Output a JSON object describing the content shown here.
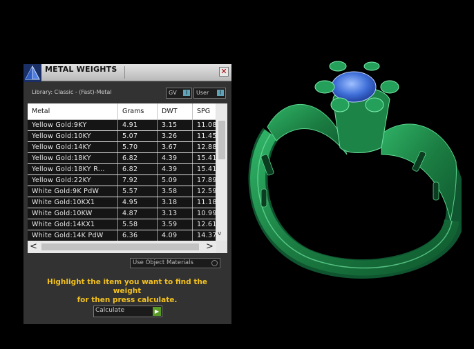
{
  "window": {
    "title": "METAL WEIGHTS",
    "close_glyph": "✕"
  },
  "library": {
    "label": "Library: Classic - (Fast)-Metal"
  },
  "toggles": {
    "gv": {
      "label": "GV",
      "indicator": "I"
    },
    "user": {
      "label": "User",
      "indicator": "I"
    }
  },
  "table": {
    "columns": [
      "Metal",
      "Grams",
      "DWT",
      "SPG"
    ],
    "rows": [
      [
        "Yellow Gold:9KY",
        "4.91",
        "3.15",
        "11.08"
      ],
      [
        "Yellow Gold:10KY",
        "5.07",
        "3.26",
        "11.45"
      ],
      [
        "Yellow Gold:14KY",
        "5.70",
        "3.67",
        "12.88"
      ],
      [
        "Yellow Gold:18KY",
        "6.82",
        "4.39",
        "15.41"
      ],
      [
        "Yellow Gold:18KY R...",
        "6.82",
        "4.39",
        "15.41"
      ],
      [
        "Yellow Gold:22KY",
        "7.92",
        "5.09",
        "17.89"
      ],
      [
        "White Gold:9K PdW",
        "5.57",
        "3.58",
        "12.59"
      ],
      [
        "White Gold:10KX1",
        "4.95",
        "3.18",
        "11.18"
      ],
      [
        "White Gold:10KW",
        "4.87",
        "3.13",
        "10.99"
      ],
      [
        "White Gold:14KX1",
        "5.58",
        "3.59",
        "12.61"
      ],
      [
        "White Gold:14K PdW",
        "6.36",
        "4.09",
        "14.37"
      ]
    ]
  },
  "scrollbar": {
    "left_glyph": "<",
    "right_glyph": ">",
    "down_glyph": "v"
  },
  "options": {
    "use_object_materials": "Use Object Materials"
  },
  "instruction": {
    "line1": "Highlight the item you want to find the weight",
    "line2": "for then press calculate."
  },
  "calculate": {
    "label": "Calculate",
    "go_glyph": "▶"
  },
  "colors": {
    "ring_metal": "#1f8a4a",
    "gem": "#3f6fd8",
    "instruction_text": "#f4c21f",
    "panel_bg": "#323232"
  },
  "icons": {
    "app_logo": "rhino-pyramid-icon",
    "close": "close-icon",
    "go": "play-arrow-icon"
  }
}
